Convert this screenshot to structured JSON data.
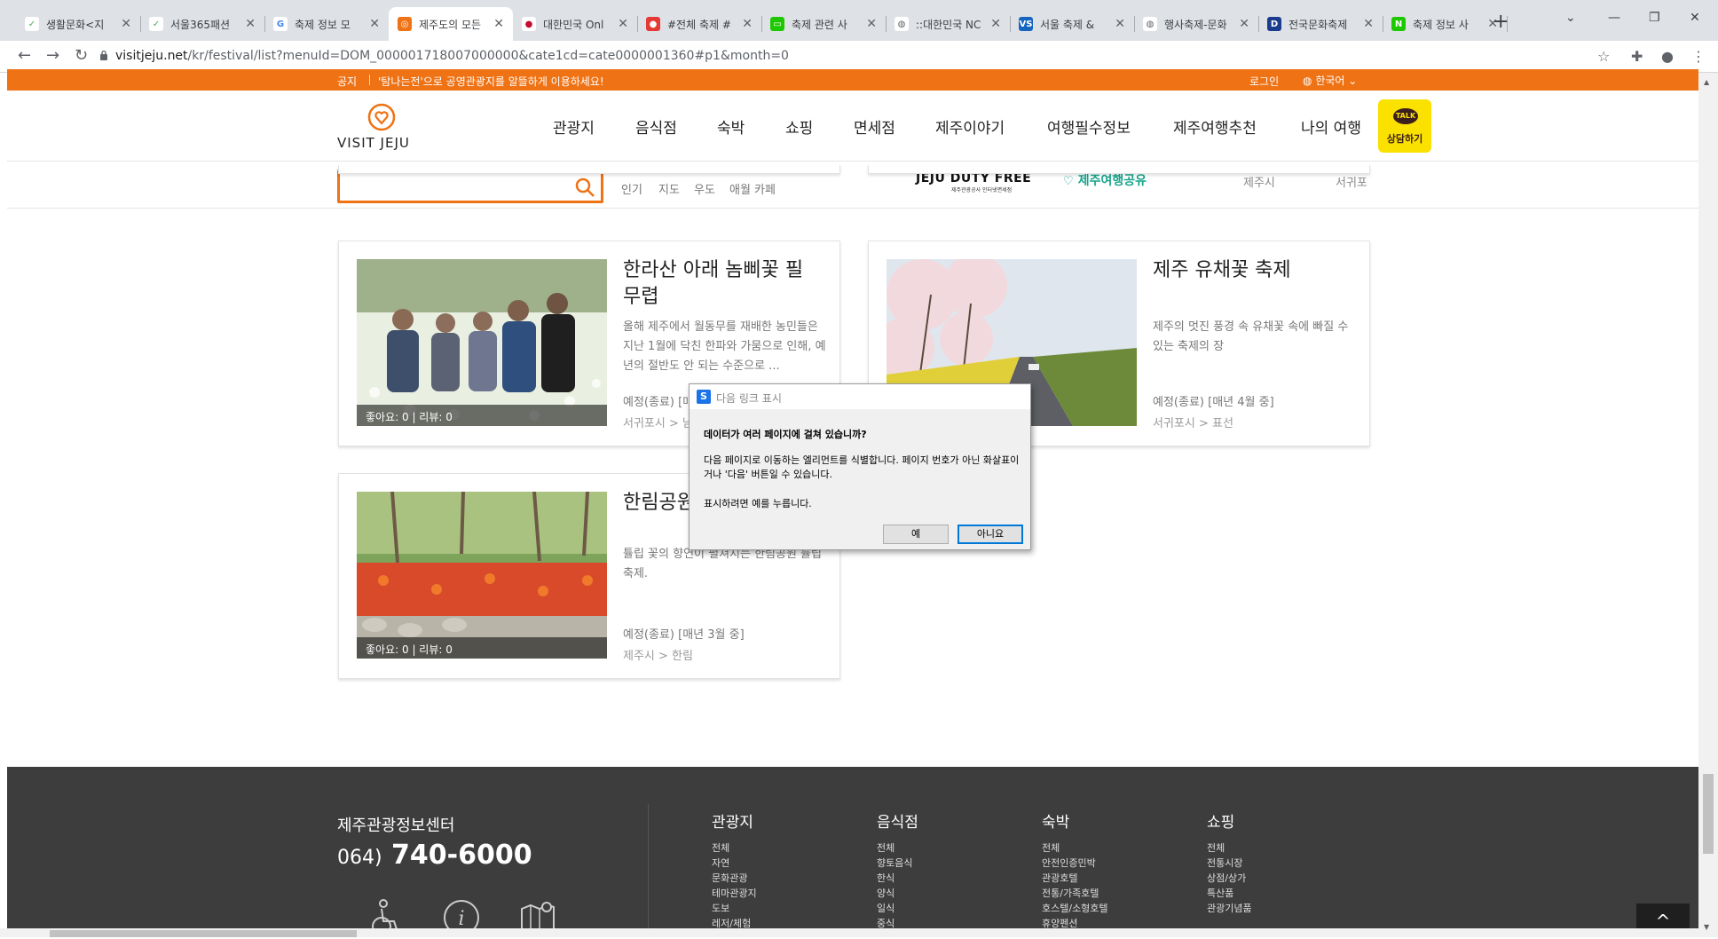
{
  "browser": {
    "tabs": [
      {
        "title": "생활문화<지",
        "fav_color": "#ffffff",
        "fav_text": "✓",
        "fav_fg": "#4caf50"
      },
      {
        "title": "서울365패션",
        "fav_color": "#ffffff",
        "fav_text": "✓",
        "fav_fg": "#4caf50"
      },
      {
        "title": "축제 정보 모",
        "fav_color": "#ffffff",
        "fav_text": "G",
        "fav_fg": "#4285f4"
      },
      {
        "title": "제주도의 모든",
        "fav_color": "#ef7214",
        "fav_text": "◎",
        "fav_fg": "#ffffff"
      },
      {
        "title": "대한민국 Onl",
        "fav_color": "#ffffff",
        "fav_text": "●",
        "fav_fg": "#c60c30"
      },
      {
        "title": "#전체 축제 #",
        "fav_color": "#e53935",
        "fav_text": "●",
        "fav_fg": "#ffffff"
      },
      {
        "title": "축제 관련 사",
        "fav_color": "#1ec800",
        "fav_text": "▭",
        "fav_fg": "#ffffff"
      },
      {
        "title": "::대한민국 NC",
        "fav_color": "#ffffff",
        "fav_text": "◍",
        "fav_fg": "#5f6368"
      },
      {
        "title": "서울 축제 &",
        "fav_color": "#1565c0",
        "fav_text": "VS",
        "fav_fg": "#ffffff"
      },
      {
        "title": "행사축제-문화",
        "fav_color": "#ffffff",
        "fav_text": "◍",
        "fav_fg": "#5f6368"
      },
      {
        "title": "전국문화축제",
        "fav_color": "#1a3c8f",
        "fav_text": "D",
        "fav_fg": "#ffffff"
      },
      {
        "title": "축제 정보 사",
        "fav_color": "#1ec800",
        "fav_text": "N",
        "fav_fg": "#ffffff"
      }
    ],
    "url_host": "visitjeju.net",
    "url_path": "/kr/festival/list?menuId=DOM_000001718007000000&cate1cd=cate0000001360#p1&month=0"
  },
  "site": {
    "notice_label": "공지",
    "notice_msg": "'탐나는전'으로 공영관광지를 알뜰하게 이용하세요!",
    "login": "로그인",
    "language": "한국어",
    "logo_text": "VISIT JEJU",
    "menu": [
      "관광지",
      "음식점",
      "숙박",
      "쇼핑",
      "면세점",
      "제주이야기",
      "여행필수정보",
      "제주여행추천",
      "나의 여행"
    ],
    "talk_badge": "TALK",
    "talk_label": "상담하기",
    "search_placeholder": "",
    "keywords": [
      "인기",
      "지도",
      "우도",
      "애월 카페"
    ],
    "dutyfree": "JEJU DUTY FREE",
    "dutyfree_sub": "제주관광공사 인터넷면세점",
    "share": "제주여행공유",
    "regions": [
      "제주시",
      "서귀포"
    ]
  },
  "cards": [
    {
      "title": "한라산 아래 놈삐꽃 필 무렵",
      "desc": "올해 제주에서 월동무를 재배한 농민들은 지난 1월에 닥친 한파와 가뭄으로 인해, 예년의 절반도 안 되는 수준으로 ...",
      "period": "예정(종료) [매",
      "loc": "서귀포시 > 남",
      "likes": "좋아요: 0",
      "reviews": "리뷰: 0"
    },
    {
      "title": "제주 유채꽃 축제",
      "desc": "제주의 멋진 풍경 속 유채꽃 속에 빠질 수 있는 축제의 장",
      "period": "예정(종료) [매년 4월 중]",
      "loc": "서귀포시 > 표선",
      "likes": "좋아요: 0",
      "reviews": "리뷰: 0"
    },
    {
      "title": "한림공원",
      "desc": "튤립 꽃의 향연이 펼쳐지는 한림공원 튤립축제.",
      "period": "예정(종료) [매년 3월 중]",
      "loc": "제주시 > 한림",
      "likes": "좋아요: 0",
      "reviews": "리뷰: 0"
    }
  ],
  "dialog": {
    "title": "다음 링크 표시",
    "question": "데이터가 여러 페이지에 걸쳐 있습니까?",
    "body": "다음 페이지로 이동하는 엘리먼트를 식별합니다. 페이지 번호가 아닌 화살표이거나 '다음' 버튼일 수 있습니다.",
    "hint": "표시하려면 예를 누릅니다.",
    "yes": "예",
    "no": "아니요"
  },
  "footer": {
    "org": "제주관광정보센터",
    "phone_prefix": "064)",
    "phone_main": "740-6000",
    "columns": [
      {
        "head": "관광지",
        "items": [
          "전체",
          "자연",
          "문화관광",
          "테마관광지",
          "도보",
          "레저/체험"
        ]
      },
      {
        "head": "음식점",
        "items": [
          "전체",
          "향토음식",
          "한식",
          "양식",
          "일식",
          "중식"
        ]
      },
      {
        "head": "숙박",
        "items": [
          "전체",
          "안전인증민박",
          "관광호텔",
          "전통/가족호텔",
          "호스텔/소형호텔",
          "휴양펜션"
        ]
      },
      {
        "head": "쇼핑",
        "items": [
          "전체",
          "전통시장",
          "상점/상가",
          "특산품",
          "관광기념품"
        ]
      }
    ],
    "to_top": "^"
  }
}
